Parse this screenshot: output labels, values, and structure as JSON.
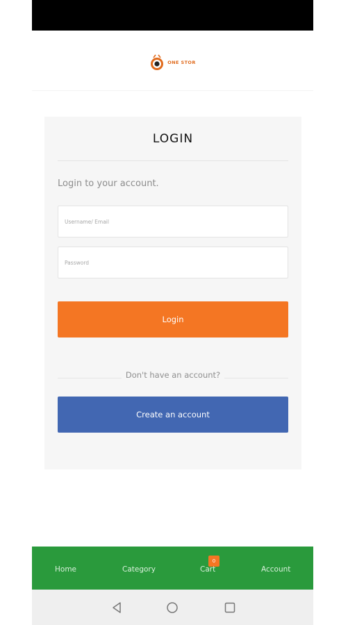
{
  "brand": {
    "name": "ONE STOR",
    "logo_icon": "eye-ring-logo",
    "accent_color": "#e06a1c"
  },
  "login": {
    "title": "LOGIN",
    "subtitle": "Login to your account.",
    "username_placeholder": "Username/ Email",
    "username_value": "",
    "password_placeholder": "Password",
    "password_value": "",
    "login_label": "Login",
    "login_color": "#f47623",
    "no_account_text": "Don't have an account?",
    "create_label": "Create an account",
    "create_color": "#4267b2"
  },
  "bottom_nav": {
    "background": "#2a9a3c",
    "items": [
      {
        "label": "Home"
      },
      {
        "label": "Category"
      },
      {
        "label": "Cart",
        "badge": "0"
      },
      {
        "label": "Account"
      }
    ]
  },
  "system_nav": {
    "back_icon": "triangle-back-icon",
    "home_icon": "circle-home-icon",
    "recents_icon": "square-recents-icon"
  }
}
